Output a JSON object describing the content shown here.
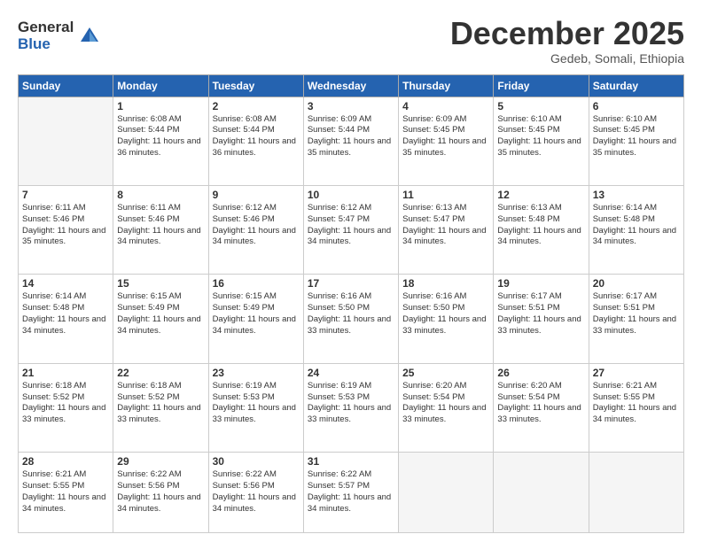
{
  "logo": {
    "general": "General",
    "blue": "Blue"
  },
  "header": {
    "month": "December 2025",
    "location": "Gedeb, Somali, Ethiopia"
  },
  "weekdays": [
    "Sunday",
    "Monday",
    "Tuesday",
    "Wednesday",
    "Thursday",
    "Friday",
    "Saturday"
  ],
  "weeks": [
    [
      {
        "day": "",
        "empty": true
      },
      {
        "day": "1",
        "sunrise": "6:08 AM",
        "sunset": "5:44 PM",
        "daylight": "11 hours and 36 minutes."
      },
      {
        "day": "2",
        "sunrise": "6:08 AM",
        "sunset": "5:44 PM",
        "daylight": "11 hours and 36 minutes."
      },
      {
        "day": "3",
        "sunrise": "6:09 AM",
        "sunset": "5:44 PM",
        "daylight": "11 hours and 35 minutes."
      },
      {
        "day": "4",
        "sunrise": "6:09 AM",
        "sunset": "5:45 PM",
        "daylight": "11 hours and 35 minutes."
      },
      {
        "day": "5",
        "sunrise": "6:10 AM",
        "sunset": "5:45 PM",
        "daylight": "11 hours and 35 minutes."
      },
      {
        "day": "6",
        "sunrise": "6:10 AM",
        "sunset": "5:45 PM",
        "daylight": "11 hours and 35 minutes."
      }
    ],
    [
      {
        "day": "7",
        "sunrise": "6:11 AM",
        "sunset": "5:46 PM",
        "daylight": "11 hours and 35 minutes."
      },
      {
        "day": "8",
        "sunrise": "6:11 AM",
        "sunset": "5:46 PM",
        "daylight": "11 hours and 34 minutes."
      },
      {
        "day": "9",
        "sunrise": "6:12 AM",
        "sunset": "5:46 PM",
        "daylight": "11 hours and 34 minutes."
      },
      {
        "day": "10",
        "sunrise": "6:12 AM",
        "sunset": "5:47 PM",
        "daylight": "11 hours and 34 minutes."
      },
      {
        "day": "11",
        "sunrise": "6:13 AM",
        "sunset": "5:47 PM",
        "daylight": "11 hours and 34 minutes."
      },
      {
        "day": "12",
        "sunrise": "6:13 AM",
        "sunset": "5:48 PM",
        "daylight": "11 hours and 34 minutes."
      },
      {
        "day": "13",
        "sunrise": "6:14 AM",
        "sunset": "5:48 PM",
        "daylight": "11 hours and 34 minutes."
      }
    ],
    [
      {
        "day": "14",
        "sunrise": "6:14 AM",
        "sunset": "5:48 PM",
        "daylight": "11 hours and 34 minutes."
      },
      {
        "day": "15",
        "sunrise": "6:15 AM",
        "sunset": "5:49 PM",
        "daylight": "11 hours and 34 minutes."
      },
      {
        "day": "16",
        "sunrise": "6:15 AM",
        "sunset": "5:49 PM",
        "daylight": "11 hours and 34 minutes."
      },
      {
        "day": "17",
        "sunrise": "6:16 AM",
        "sunset": "5:50 PM",
        "daylight": "11 hours and 33 minutes."
      },
      {
        "day": "18",
        "sunrise": "6:16 AM",
        "sunset": "5:50 PM",
        "daylight": "11 hours and 33 minutes."
      },
      {
        "day": "19",
        "sunrise": "6:17 AM",
        "sunset": "5:51 PM",
        "daylight": "11 hours and 33 minutes."
      },
      {
        "day": "20",
        "sunrise": "6:17 AM",
        "sunset": "5:51 PM",
        "daylight": "11 hours and 33 minutes."
      }
    ],
    [
      {
        "day": "21",
        "sunrise": "6:18 AM",
        "sunset": "5:52 PM",
        "daylight": "11 hours and 33 minutes."
      },
      {
        "day": "22",
        "sunrise": "6:18 AM",
        "sunset": "5:52 PM",
        "daylight": "11 hours and 33 minutes."
      },
      {
        "day": "23",
        "sunrise": "6:19 AM",
        "sunset": "5:53 PM",
        "daylight": "11 hours and 33 minutes."
      },
      {
        "day": "24",
        "sunrise": "6:19 AM",
        "sunset": "5:53 PM",
        "daylight": "11 hours and 33 minutes."
      },
      {
        "day": "25",
        "sunrise": "6:20 AM",
        "sunset": "5:54 PM",
        "daylight": "11 hours and 33 minutes."
      },
      {
        "day": "26",
        "sunrise": "6:20 AM",
        "sunset": "5:54 PM",
        "daylight": "11 hours and 33 minutes."
      },
      {
        "day": "27",
        "sunrise": "6:21 AM",
        "sunset": "5:55 PM",
        "daylight": "11 hours and 34 minutes."
      }
    ],
    [
      {
        "day": "28",
        "sunrise": "6:21 AM",
        "sunset": "5:55 PM",
        "daylight": "11 hours and 34 minutes."
      },
      {
        "day": "29",
        "sunrise": "6:22 AM",
        "sunset": "5:56 PM",
        "daylight": "11 hours and 34 minutes."
      },
      {
        "day": "30",
        "sunrise": "6:22 AM",
        "sunset": "5:56 PM",
        "daylight": "11 hours and 34 minutes."
      },
      {
        "day": "31",
        "sunrise": "6:22 AM",
        "sunset": "5:57 PM",
        "daylight": "11 hours and 34 minutes."
      },
      {
        "day": "",
        "empty": true
      },
      {
        "day": "",
        "empty": true
      },
      {
        "day": "",
        "empty": true
      }
    ]
  ]
}
